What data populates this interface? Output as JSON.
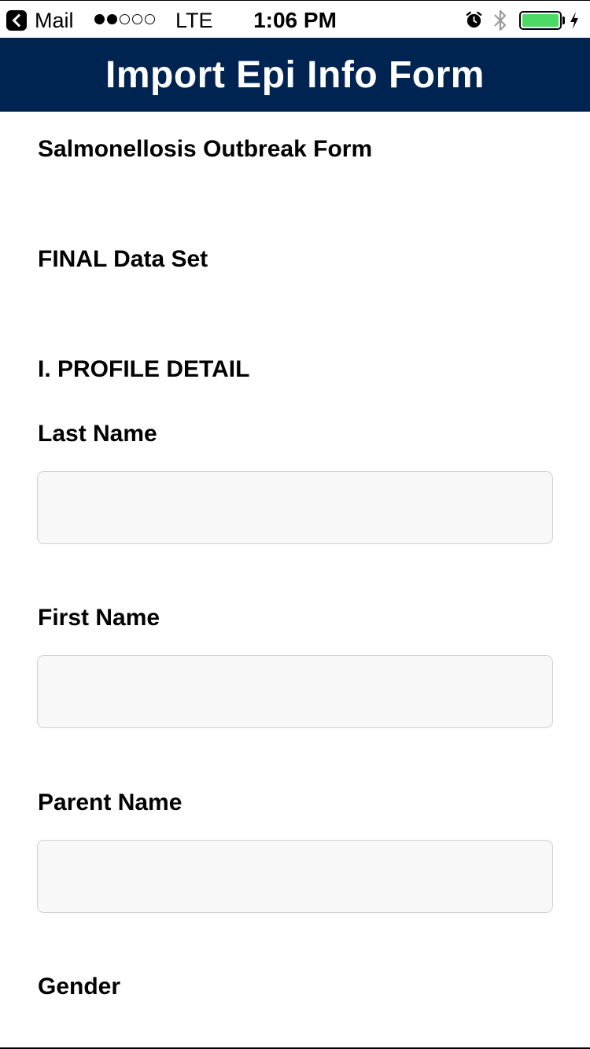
{
  "status_bar": {
    "back_app": "Mail",
    "signal_bars": [
      true,
      true,
      false,
      false,
      false
    ],
    "carrier": "LTE",
    "time": "1:06 PM",
    "battery_level": 1.0,
    "icons": [
      "back-arrow-icon",
      "alarm-icon",
      "bluetooth-icon",
      "battery-icon",
      "charging-icon"
    ]
  },
  "header": {
    "title": "Import Epi Info Form",
    "background": "#002451"
  },
  "form": {
    "title": "Salmonellosis Outbreak Form",
    "subtitle": "FINAL Data Set",
    "section": "I. PROFILE DETAIL",
    "fields": [
      {
        "label": "Last Name",
        "value": "",
        "placeholder": ""
      },
      {
        "label": "First Name",
        "value": "",
        "placeholder": ""
      },
      {
        "label": "Parent Name",
        "value": "",
        "placeholder": ""
      },
      {
        "label": "Gender",
        "value": "",
        "placeholder": ""
      }
    ]
  }
}
